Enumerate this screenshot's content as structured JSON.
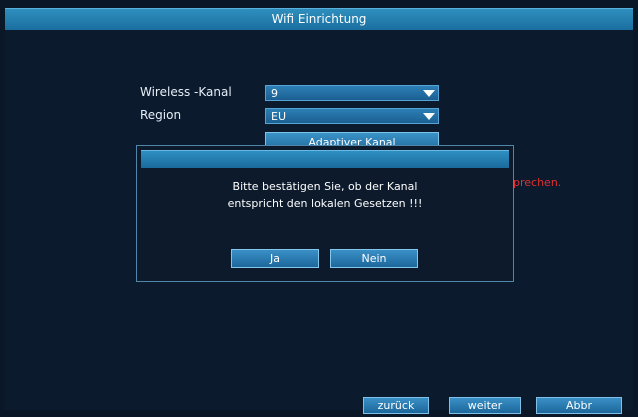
{
  "window": {
    "title": "Wifi Einrichtung"
  },
  "form": {
    "channel_label": "Wireless -Kanal",
    "channel_value": "9",
    "region_label": "Region",
    "region_value": "EU",
    "adaptive_button": "Adaptiver Kanal",
    "warning_partial": "prechen."
  },
  "dialog": {
    "message_line1": "Bitte bestätigen Sie, ob der Kanal",
    "message_line2": "entspricht den lokalen Gesetzen !!!",
    "yes_label": "Ja",
    "no_label": "Nein"
  },
  "footer": {
    "back_label": "zurück",
    "next_label": "weiter",
    "cancel_label": "Abbr"
  }
}
